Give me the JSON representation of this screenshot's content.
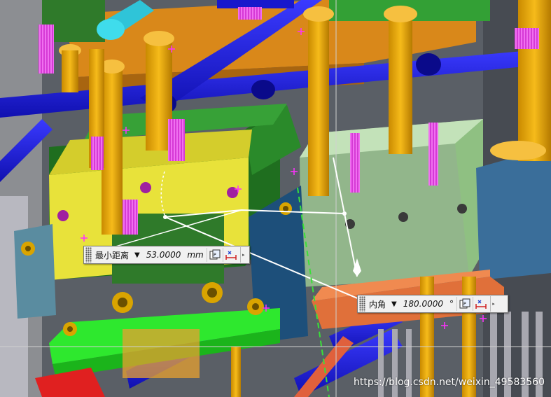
{
  "dimension_distance": {
    "label": "最小距离",
    "dropdown_icon": "triangle-down-icon",
    "value": "53.0000",
    "unit": "mm",
    "options_icon": "properties-icon",
    "flip_icon": "flip-dimension-icon"
  },
  "dimension_angle": {
    "label": "内角",
    "dropdown_icon": "triangle-down-icon",
    "value": "180.0000",
    "unit": "°",
    "options_icon": "properties-icon",
    "flip_icon": "flip-dimension-icon"
  },
  "watermark": {
    "text": "https://blog.csdn.net/weixin_49583560"
  },
  "colors": {
    "yellow_plate": "#e8e23a",
    "green_plate": "#2f8a2a",
    "blue_rod": "#1a1ad8",
    "orange_pin": "#f0a200",
    "magenta_thread": "#e040e0",
    "transparent_block": "#a8d89a",
    "dark_blue_block": "#1f5a8a",
    "orange_slab": "#e8743a",
    "light_green": "#2ee82e",
    "red_part": "#e02020",
    "teal": "#46c7d8"
  }
}
